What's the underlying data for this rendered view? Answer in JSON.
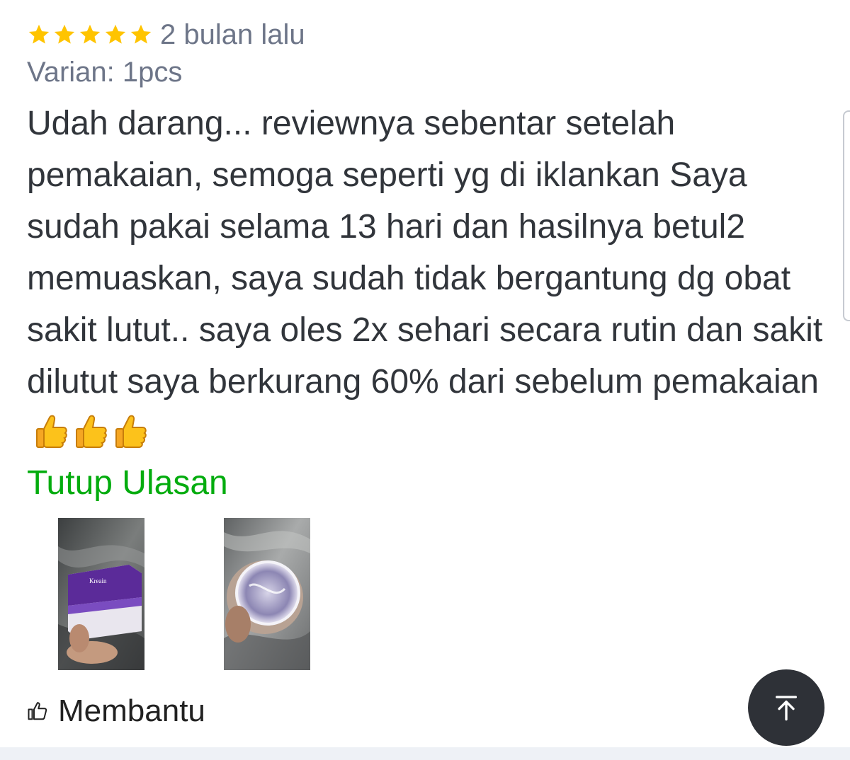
{
  "review": {
    "rating": 5,
    "time_ago": "2 bulan lalu",
    "variant": "Varian: 1pcs",
    "text": "Udah darang... reviewnya sebentar setelah pemakaian, semoga seperti yg di iklankan Saya sudah pakai selama 13 hari dan hasilnya betul2 memuaskan, saya sudah tidak bergantung dg obat sakit lutut.. saya oles 2x sehari secara rutin dan sakit dilutut saya berkurang 60% dari sebelum pemakaian",
    "emoji": "thumbs-up x3",
    "collapse_label": "Tutup Ulasan",
    "photos": [
      {
        "label": "Kreain"
      },
      {
        "label": ""
      }
    ]
  },
  "actions": {
    "helpful_label": "Membantu",
    "helpful_icon": "thumbs-up-outline-icon",
    "scroll_top_icon": "arrow-up-to-top-icon"
  },
  "colors": {
    "star": "#ffc400",
    "link_green": "#03ac0e",
    "meta_gray": "#6d7588",
    "body_text": "#31353b",
    "fab_bg": "#2e3137"
  }
}
